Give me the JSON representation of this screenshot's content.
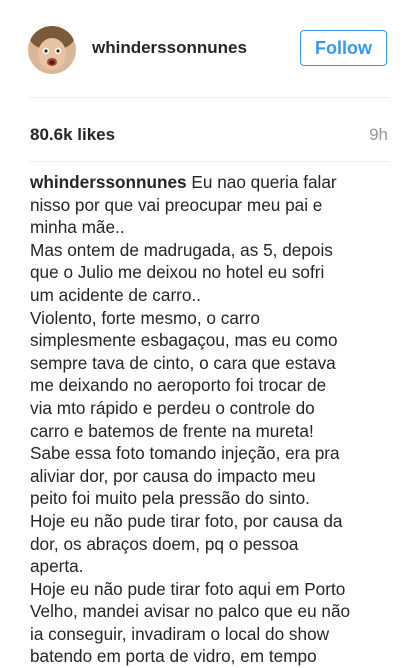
{
  "post": {
    "username": "whinderssonnunes",
    "follow_label": "Follow",
    "likes": "80.6k likes",
    "time": "9h",
    "caption_user": "whinderssonnunes",
    "caption_lines": [
      "Eu nao queria falar",
      "nisso por que vai preocupar meu pai e",
      "minha mãe..",
      "Mas ontem de madrugada, as 5, depois",
      "que o Julio me deixou no hotel eu sofri",
      "um acidente de carro..",
      "Violento, forte mesmo, o carro",
      "simplesmente esbagaçou, mas eu como",
      "sempre tava de cinto, o cara que estava",
      "me deixando no aeroporto foi trocar de",
      "via mto rápido e perdeu o controle do",
      "carro e batemos de frente na mureta!",
      "Sabe essa foto tomando injeção, era pra",
      "aliviar dor, por causa do impacto meu",
      "peito foi muito pela pressão do sinto.",
      "Hoje eu não pude tirar foto, por causa da",
      "dor, os abraços doem, pq o pessoa",
      "aperta.",
      "Hoje eu não pude tirar foto aqui em Porto",
      "Velho, mandei avisar no palco que eu não",
      "ia conseguir, invadiram o local do show",
      "batendo em porta de vidro, em tempo"
    ]
  },
  "colors": {
    "accent": "#3897f0",
    "text": "#262626",
    "muted": "#999999",
    "divider": "#efefef"
  }
}
